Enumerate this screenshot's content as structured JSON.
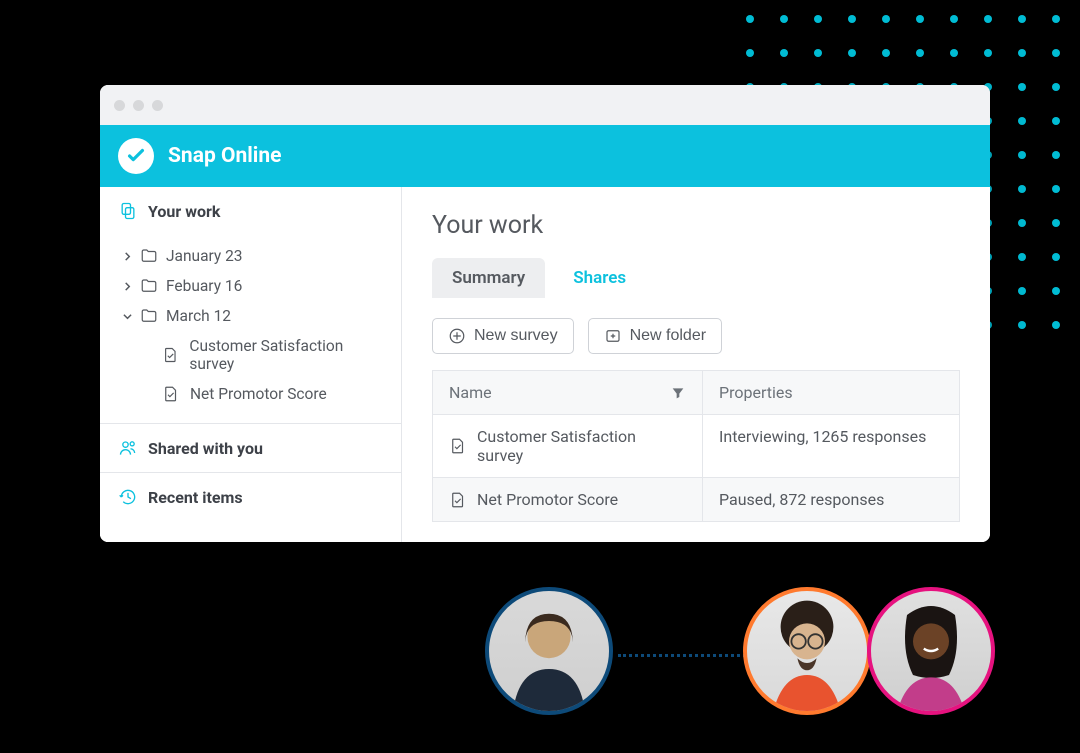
{
  "app": {
    "title": "Snap Online"
  },
  "sidebar": {
    "your_work": {
      "label": "Your work"
    },
    "folders": [
      {
        "label": "January 23",
        "expanded": false
      },
      {
        "label": "Febuary 16",
        "expanded": false
      },
      {
        "label": "March 12",
        "expanded": true
      }
    ],
    "children": [
      {
        "label": "Customer Satisfaction survey"
      },
      {
        "label": "Net Promotor Score"
      }
    ],
    "shared": {
      "label": "Shared with you"
    },
    "recent": {
      "label": "Recent items"
    }
  },
  "main": {
    "title": "Your work",
    "tabs": {
      "summary": "Summary",
      "shares": "Shares"
    },
    "buttons": {
      "new_survey": "New survey",
      "new_folder": "New folder"
    },
    "columns": {
      "name": "Name",
      "properties": "Properties"
    },
    "rows": [
      {
        "name": "Customer Satisfaction survey",
        "props": "Interviewing, 1265 responses"
      },
      {
        "name": "Net Promotor Score",
        "props": "Paused, 872 responses"
      }
    ]
  },
  "colors": {
    "accent": "#0cc1de",
    "avatar_borders": [
      "#0d4a79",
      "#ff7a2e",
      "#e6127f"
    ]
  }
}
